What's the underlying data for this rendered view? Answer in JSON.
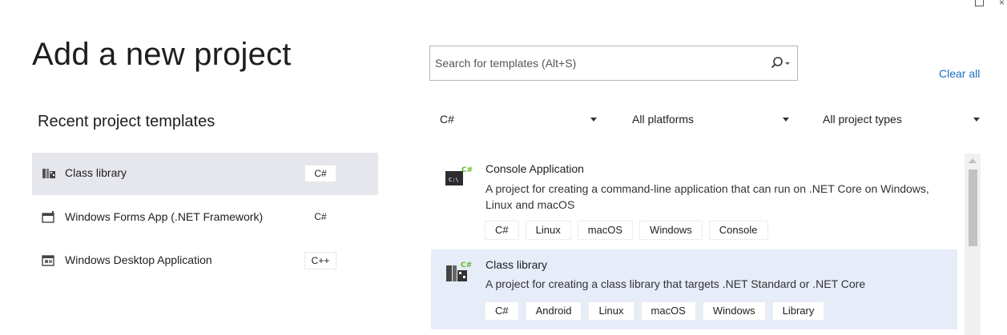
{
  "page_title": "Add a new project",
  "search": {
    "placeholder": "Search for templates (Alt+S)",
    "value": ""
  },
  "clear_all": "Clear all",
  "recent": {
    "heading": "Recent project templates",
    "items": [
      {
        "label": "Class library",
        "lang": "C#",
        "icon": "class-library-icon",
        "selected": true
      },
      {
        "label": "Windows Forms App (.NET Framework)",
        "lang": "C#",
        "icon": "windows-form-icon",
        "selected": false
      },
      {
        "label": "Windows Desktop Application",
        "lang": "C++",
        "icon": "desktop-app-icon",
        "selected": false
      }
    ]
  },
  "filters": {
    "language": "C#",
    "platform": "All platforms",
    "project_type": "All project types"
  },
  "templates": [
    {
      "name": "Console Application",
      "description": "A project for creating a command-line application that can run on .NET Core on Windows, Linux and macOS",
      "icon": "console-app-icon",
      "icon_badge": "C#",
      "icon_text": "C:\\",
      "tags": [
        "C#",
        "Linux",
        "macOS",
        "Windows",
        "Console"
      ],
      "selected": false
    },
    {
      "name": "Class library",
      "description": "A project for creating a class library that targets .NET Standard or .NET Core",
      "icon": "class-library-icon",
      "icon_badge": "C#",
      "tags": [
        "C#",
        "Android",
        "Linux",
        "macOS",
        "Windows",
        "Library"
      ],
      "selected": true
    }
  ],
  "colors": {
    "accent": "#1a6fc4",
    "selected_bg": "#e6ecf8",
    "recent_selected_bg": "#e6e7ed",
    "csharp_green": "#68b723"
  }
}
